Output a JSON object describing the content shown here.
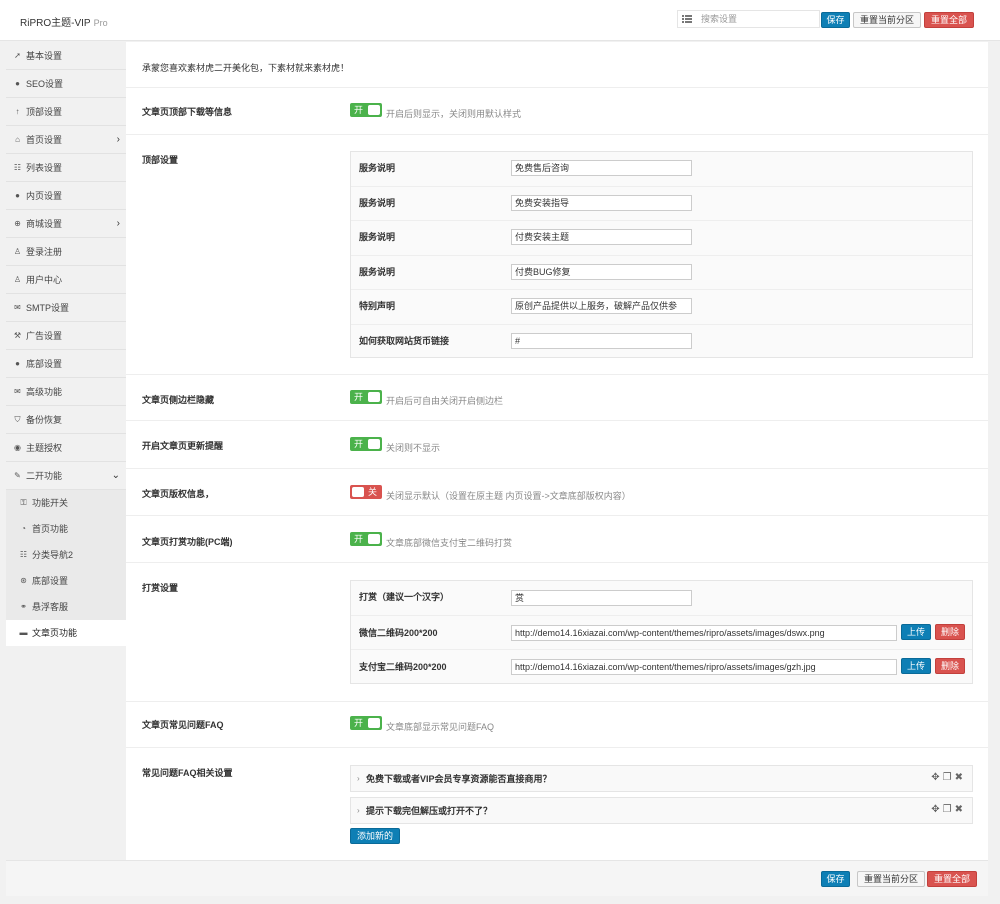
{
  "header": {
    "brand": "RiPRO主题-VIP",
    "version": "Pro",
    "search_placeholder": "搜索设置",
    "save_label": "保存",
    "reset_section_label": "重置当前分区",
    "reset_all_label": "重置全部"
  },
  "sidebar": {
    "items": [
      {
        "label": "基本设置",
        "icon": "rocket-icon",
        "glyph": "➚"
      },
      {
        "label": "SEO设置",
        "icon": "circle-icon",
        "glyph": "●"
      },
      {
        "label": "顶部设置",
        "icon": "arrow-up-icon",
        "glyph": "↑"
      },
      {
        "label": "首页设置",
        "icon": "home-icon",
        "glyph": "⌂",
        "arrow": "›"
      },
      {
        "label": "列表设置",
        "icon": "list-icon",
        "glyph": "☷"
      },
      {
        "label": "内页设置",
        "icon": "circle-icon",
        "glyph": "●"
      },
      {
        "label": "商城设置",
        "icon": "plus-circle-icon",
        "glyph": "⊕",
        "arrow": "›"
      },
      {
        "label": "登录注册",
        "icon": "user-icon",
        "glyph": "♙"
      },
      {
        "label": "用户中心",
        "icon": "user-icon",
        "glyph": "♙"
      },
      {
        "label": "SMTP设置",
        "icon": "envelope-icon",
        "glyph": "✉"
      },
      {
        "label": "广告设置",
        "icon": "gavel-icon",
        "glyph": "⚒"
      },
      {
        "label": "底部设置",
        "icon": "circle-icon",
        "glyph": "●"
      },
      {
        "label": "高级功能",
        "icon": "envelope-icon",
        "glyph": "✉"
      },
      {
        "label": "备份恢复",
        "icon": "shield-icon",
        "glyph": "⛉"
      },
      {
        "label": "主题授权",
        "icon": "eye-icon",
        "glyph": "◉"
      },
      {
        "label": "二开功能",
        "icon": "wrench-icon",
        "glyph": "✎",
        "arrow": "⌄"
      }
    ],
    "subitems": [
      {
        "label": "功能开关",
        "icon": "lock-icon",
        "glyph": "⚿"
      },
      {
        "label": "首页功能",
        "icon": "dashboard-icon",
        "glyph": "◔"
      },
      {
        "label": "分类导航2",
        "icon": "list-icon",
        "glyph": "☷"
      },
      {
        "label": "底部设置",
        "icon": "compass-icon",
        "glyph": "⊛"
      },
      {
        "label": "悬浮客服",
        "icon": "link-icon",
        "glyph": "⚭"
      },
      {
        "label": "文章页功能",
        "icon": "book-icon",
        "glyph": "▬"
      }
    ]
  },
  "main": {
    "notice": "承蒙您喜欢素材虎二开美化包，下素材就来素材虎！",
    "top_download": {
      "title": "文章页顶部下载等信息",
      "switch": "开",
      "desc": "开启后则显示，关闭则用默认样式"
    },
    "top_settings": {
      "title": "顶部设置",
      "rows": [
        {
          "label": "服务说明",
          "value": "免费售后咨询"
        },
        {
          "label": "服务说明",
          "value": "免费安装指导"
        },
        {
          "label": "服务说明",
          "value": "付费安装主题"
        },
        {
          "label": "服务说明",
          "value": "付费BUG修复"
        },
        {
          "label": "特别声明",
          "value": "原创产品提供以上服务，破解产品仅供参"
        },
        {
          "label": "如何获取网站货币链接",
          "value": "#"
        }
      ]
    },
    "sidebar_hide": {
      "title": "文章页侧边栏隐藏",
      "switch": "开",
      "desc": "开启后可自由关闭开启侧边栏"
    },
    "update_remind": {
      "title": "开启文章页更新提醒",
      "switch": "开",
      "desc": "关闭则不显示"
    },
    "copyright": {
      "title": "文章页版权信息，",
      "switch": "关",
      "desc": "关闭显示默认（设置在原主题 内页设置->文章底部版权内容）"
    },
    "reward": {
      "title": "文章页打赏功能(PC端)",
      "switch": "开",
      "desc": "文章底部微信支付宝二维码打赏"
    },
    "reward_settings": {
      "title": "打赏设置",
      "rows": [
        {
          "label": "打赏（建议一个汉字）",
          "value": "赏"
        },
        {
          "label": "微信二维码200*200",
          "value": "http://demo14.16xiazai.com/wp-content/themes/ripro/assets/images/dswx.png",
          "upload": "上传",
          "delete": "删除"
        },
        {
          "label": "支付宝二维码200*200",
          "value": "http://demo14.16xiazai.com/wp-content/themes/ripro/assets/images/gzh.jpg",
          "upload": "上传",
          "delete": "删除"
        }
      ]
    },
    "faq": {
      "title": "文章页常见问题FAQ",
      "switch": "开",
      "desc": "文章底部显示常见问题FAQ"
    },
    "faq_settings": {
      "title": "常见问题FAQ相关设置",
      "items": [
        "免费下载或者VIP会员专享资源能否直接商用？",
        "提示下载完但解压或打开不了？"
      ],
      "add_label": "添加新的"
    }
  },
  "footer": {
    "save_label": "保存",
    "reset_section_label": "重置当前分区",
    "reset_all_label": "重置全部"
  },
  "colors": {
    "accent": "#0e7fb5",
    "switch_on": "#4bb24b",
    "danger": "#d9534f"
  }
}
